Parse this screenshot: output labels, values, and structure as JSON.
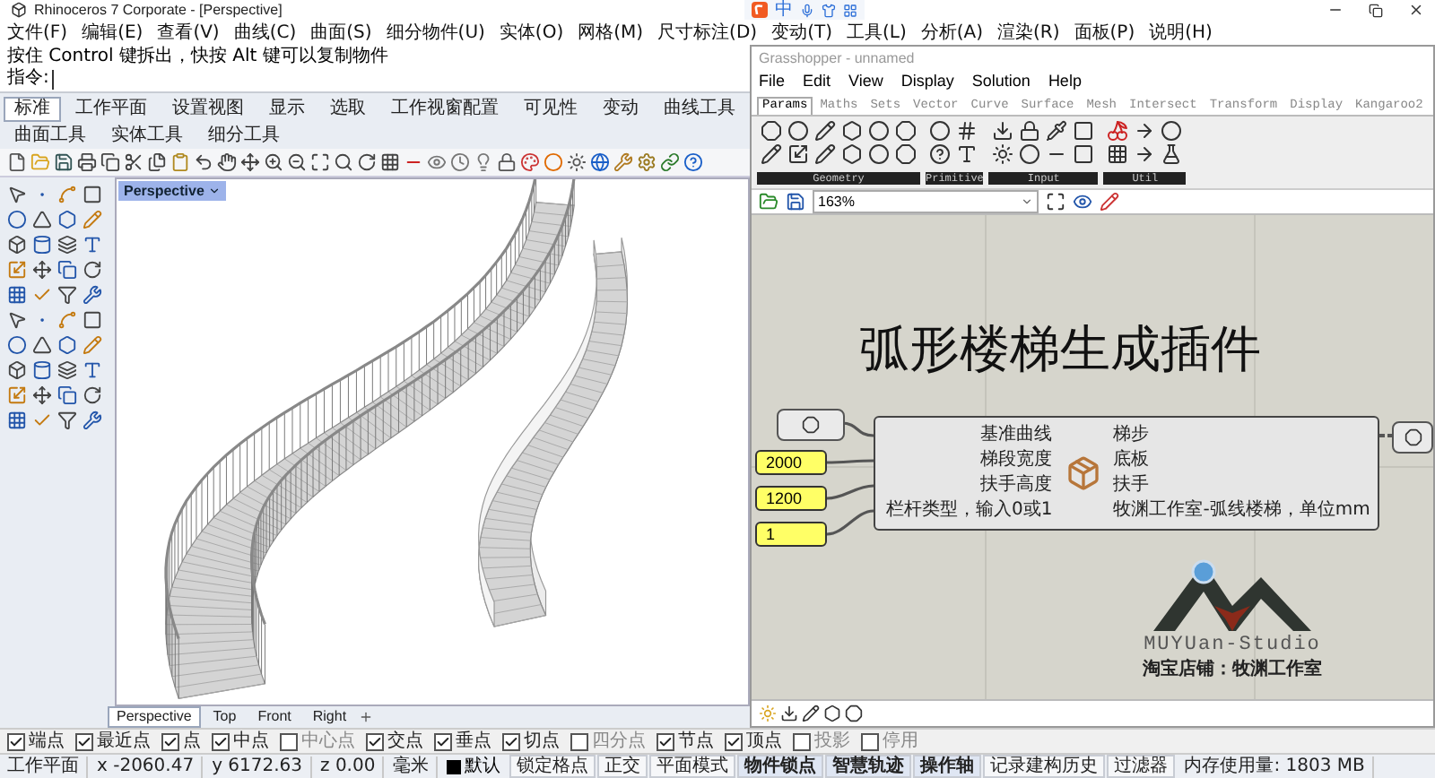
{
  "window": {
    "title": "Rhinoceros 7 Corporate - [Perspective]"
  },
  "ime_bar": {
    "mode": "中"
  },
  "menu": [
    "文件(F)",
    "编辑(E)",
    "查看(V)",
    "曲线(C)",
    "曲面(S)",
    "细分物件(U)",
    "实体(O)",
    "网格(M)",
    "尺寸标注(D)",
    "变动(T)",
    "工具(L)",
    "分析(A)",
    "渲染(R)",
    "面板(P)",
    "说明(H)"
  ],
  "command": {
    "message": "按住 Control 键拆出，快按 Alt 键可以复制物件",
    "prompt": "指令:"
  },
  "tabs": [
    {
      "label": "标准",
      "selected": true
    },
    {
      "label": "工作平面",
      "selected": false
    },
    {
      "label": "设置视图",
      "selected": false
    },
    {
      "label": "显示",
      "selected": false
    },
    {
      "label": "选取",
      "selected": false
    },
    {
      "label": "工作视窗配置",
      "selected": false
    },
    {
      "label": "可见性",
      "selected": false
    },
    {
      "label": "变动",
      "selected": false
    },
    {
      "label": "曲线工具",
      "selected": false
    },
    {
      "label": "曲面工具",
      "selected": false
    },
    {
      "label": "实体工具",
      "selected": false
    },
    {
      "label": "细分工具",
      "selected": false
    }
  ],
  "viewport": {
    "label": "Perspective"
  },
  "viewport_tabs": [
    {
      "label": "Perspective",
      "selected": true
    },
    {
      "label": "Top",
      "selected": false
    },
    {
      "label": "Front",
      "selected": false
    },
    {
      "label": "Right",
      "selected": false
    }
  ],
  "snaps": [
    {
      "label": "端点",
      "checked": true
    },
    {
      "label": "最近点",
      "checked": true
    },
    {
      "label": "点",
      "checked": true
    },
    {
      "label": "中点",
      "checked": true
    },
    {
      "label": "中心点",
      "checked": false
    },
    {
      "label": "交点",
      "checked": true
    },
    {
      "label": "垂点",
      "checked": true
    },
    {
      "label": "切点",
      "checked": true
    },
    {
      "label": "四分点",
      "checked": false
    },
    {
      "label": "节点",
      "checked": true
    },
    {
      "label": "顶点",
      "checked": true
    },
    {
      "label": "投影",
      "checked": false
    },
    {
      "label": "停用",
      "checked": false
    }
  ],
  "status_bar": {
    "plane": "工作平面",
    "coords": [
      "x -2060.47",
      "y 6172.63",
      "z 0.00"
    ],
    "units": "毫米",
    "layer": "默认",
    "toggles": [
      {
        "label": "锁定格点",
        "on": false
      },
      {
        "label": "正交",
        "on": false
      },
      {
        "label": "平面模式",
        "on": false
      },
      {
        "label": "物件锁点",
        "on": true
      },
      {
        "label": "智慧轨迹",
        "on": true
      },
      {
        "label": "操作轴",
        "on": true
      },
      {
        "label": "记录建构历史",
        "on": false
      },
      {
        "label": "过滤器",
        "on": false
      }
    ],
    "memory": "内存使用量: 1803 MB"
  },
  "grasshopper": {
    "title": "Grasshopper - unnamed",
    "menu": [
      "File",
      "Edit",
      "View",
      "Display",
      "Solution",
      "Help"
    ],
    "tabs": [
      {
        "label": "Params",
        "selected": true
      },
      {
        "label": "Maths",
        "selected": false
      },
      {
        "label": "Sets",
        "selected": false
      },
      {
        "label": "Vector",
        "selected": false
      },
      {
        "label": "Curve",
        "selected": false
      },
      {
        "label": "Surface",
        "selected": false
      },
      {
        "label": "Mesh",
        "selected": false
      },
      {
        "label": "Intersect",
        "selected": false
      },
      {
        "label": "Transform",
        "selected": false
      },
      {
        "label": "Display",
        "selected": false
      },
      {
        "label": "Kangaroo2",
        "selected": false
      }
    ],
    "groups": [
      "Geometry",
      "Primitive",
      "Input",
      "Util"
    ],
    "zoom": "163%",
    "canvas": {
      "title": "弧形楼梯生成插件",
      "sources": [
        {
          "kind": "param"
        },
        {
          "kind": "panel",
          "value": "2000"
        },
        {
          "kind": "panel",
          "value": "1200"
        },
        {
          "kind": "panel",
          "value": "1"
        }
      ],
      "component": {
        "inputs": [
          "基准曲线",
          "梯段宽度",
          "扶手高度",
          "栏杆类型，输入0或1"
        ],
        "outputs": [
          "梯步",
          "底板",
          "扶手",
          "牧渊工作室-弧线楼梯，单位mm"
        ]
      },
      "logo": {
        "name": "MUYUan-Studio",
        "caption": "淘宝店铺：牧渊工作室"
      }
    }
  }
}
